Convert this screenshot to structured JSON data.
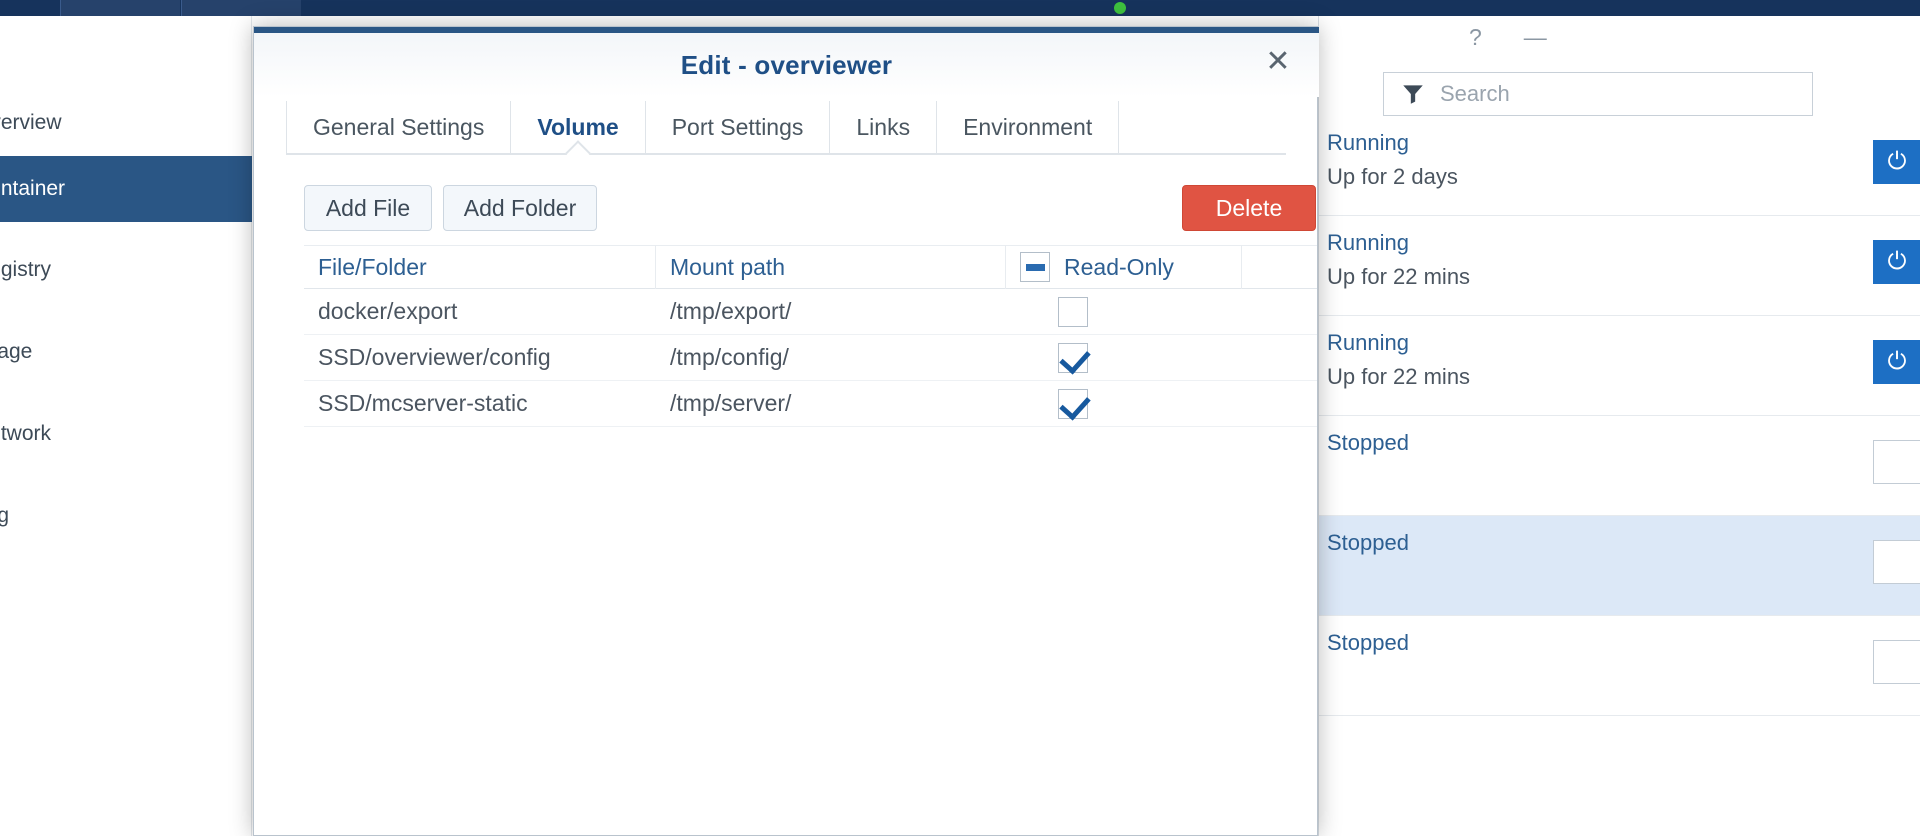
{
  "background": {
    "sidebar": {
      "items": [
        {
          "label": "Overview",
          "active": false
        },
        {
          "label": "Container",
          "active": true
        },
        {
          "label": "Registry",
          "active": false
        },
        {
          "label": "Image",
          "active": false
        },
        {
          "label": "Network",
          "active": false
        },
        {
          "label": "Log",
          "active": false
        }
      ]
    },
    "window_controls": {
      "help": "?",
      "minimize": "—"
    },
    "search": {
      "placeholder": "Search",
      "icon": "filter-funnel-icon"
    },
    "container_rows": [
      {
        "status": "Running",
        "uptime": "Up for 2 days",
        "toggle_on": true,
        "selected": false
      },
      {
        "status": "Running",
        "uptime": "Up for 22 mins",
        "toggle_on": true,
        "selected": false
      },
      {
        "status": "Running",
        "uptime": "Up for 22 mins",
        "toggle_on": true,
        "selected": false
      },
      {
        "status": "Stopped",
        "uptime": "",
        "toggle_on": false,
        "selected": false
      },
      {
        "status": "Stopped",
        "uptime": "",
        "toggle_on": false,
        "selected": true
      },
      {
        "status": "Stopped",
        "uptime": "",
        "toggle_on": false,
        "selected": false
      }
    ]
  },
  "modal": {
    "title": "Edit - overviewer",
    "close_label": "✕",
    "tabs": [
      {
        "label": "General Settings",
        "active": false
      },
      {
        "label": "Volume",
        "active": true
      },
      {
        "label": "Port Settings",
        "active": false
      },
      {
        "label": "Links",
        "active": false
      },
      {
        "label": "Environment",
        "active": false
      }
    ],
    "toolbar": {
      "add_file_label": "Add File",
      "add_folder_label": "Add Folder",
      "delete_label": "Delete"
    },
    "table": {
      "headers": {
        "file_folder": "File/Folder",
        "mount_path": "Mount path",
        "read_only": "Read-Only",
        "read_only_state": "indeterminate"
      },
      "rows": [
        {
          "file_folder": "docker/export",
          "mount_path": "/tmp/export/",
          "read_only": false
        },
        {
          "file_folder": "SSD/overviewer/config",
          "mount_path": "/tmp/config/",
          "read_only": true
        },
        {
          "file_folder": "SSD/mcserver-static",
          "mount_path": "/tmp/server/",
          "read_only": true
        }
      ]
    }
  },
  "colors": {
    "accent_blue": "#2a5685",
    "title_blue": "#1f4f86",
    "link_blue": "#2d5f92",
    "danger_red": "#e05443",
    "check_blue": "#17599e",
    "toggle_blue": "#1d6fc4",
    "row_selected": "#dce8f7"
  }
}
